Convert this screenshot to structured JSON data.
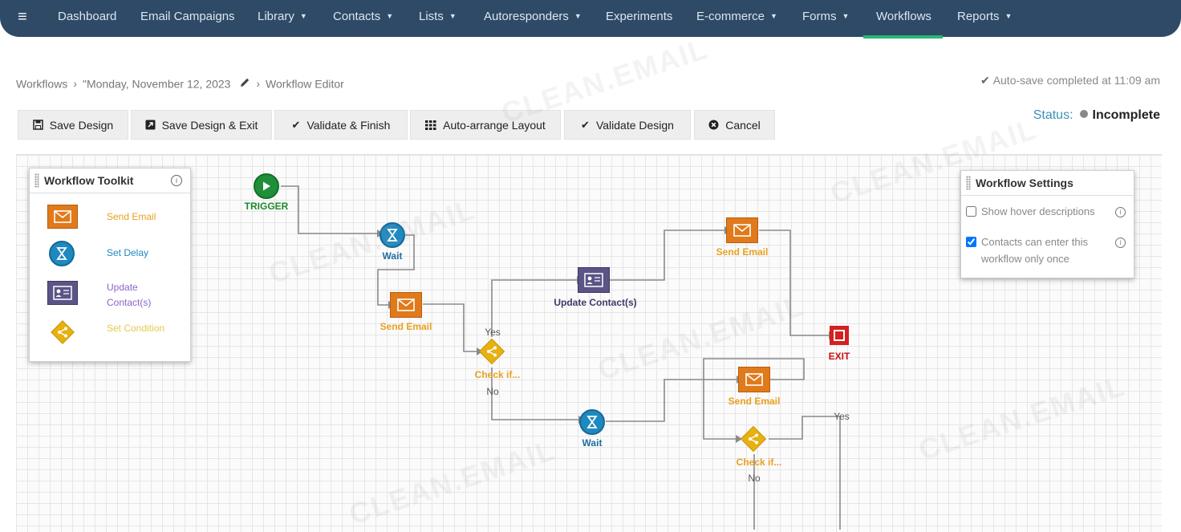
{
  "nav": {
    "items": [
      {
        "label": "Dashboard",
        "dropdown": false
      },
      {
        "label": "Email Campaigns",
        "dropdown": false
      },
      {
        "label": "Library",
        "dropdown": true
      },
      {
        "label": "Contacts",
        "dropdown": true
      },
      {
        "label": "Lists",
        "dropdown": true
      },
      {
        "label": "Autoresponders",
        "dropdown": true
      },
      {
        "label": "Experiments",
        "dropdown": false
      },
      {
        "label": "E-commerce",
        "dropdown": true
      },
      {
        "label": "Forms",
        "dropdown": true
      },
      {
        "label": "Workflows",
        "dropdown": false,
        "active": true
      },
      {
        "label": "Reports",
        "dropdown": true
      }
    ]
  },
  "breadcrumb": {
    "root": "Workflows",
    "workflow_name": "\"Monday, November 12, 2023",
    "current": "Workflow Editor"
  },
  "autosave": "Auto-save completed at 11:09 am",
  "status": {
    "label": "Status:",
    "value": "Incomplete"
  },
  "toolbar": {
    "save_design": "Save Design",
    "save_exit": "Save Design & Exit",
    "validate_finish": "Validate & Finish",
    "auto_arrange": "Auto-arrange Layout",
    "validate_design": "Validate Design",
    "cancel": "Cancel"
  },
  "toolkit": {
    "title": "Workflow Toolkit",
    "items": [
      {
        "label": "Send Email",
        "icon": "envelope-icon",
        "color": "#e8a020"
      },
      {
        "label": "Set Delay",
        "icon": "hourglass-icon",
        "color": "#1f88c0"
      },
      {
        "label": "Update Contact(s)",
        "icon": "contact-card-icon",
        "color": "#8a63c9"
      },
      {
        "label": "Set Condition",
        "icon": "branch-icon",
        "color": "#e5c850"
      }
    ]
  },
  "settings": {
    "title": "Workflow Settings",
    "options": [
      {
        "label": "Show hover descriptions",
        "checked": false
      },
      {
        "label": "Contacts can enter this workflow only once",
        "checked": true
      }
    ]
  },
  "flow": {
    "trigger": "TRIGGER",
    "wait": "Wait",
    "send_email": "Send Email",
    "check_if": "Check if...",
    "update_contacts": "Update Contact(s)",
    "exit": "EXIT",
    "yes": "Yes",
    "no": "No"
  },
  "watermark": "CLEAN.EMAIL",
  "colors": {
    "nav_bg": "#2e4a66",
    "nav_active": "#2bb673",
    "email_orange": "#e07a1a",
    "delay_blue": "#1e88c0",
    "update_purple": "#5a5487",
    "condition_yellow": "#e8b010",
    "trigger_green": "#1f8f3a",
    "exit_red": "#d42020"
  }
}
